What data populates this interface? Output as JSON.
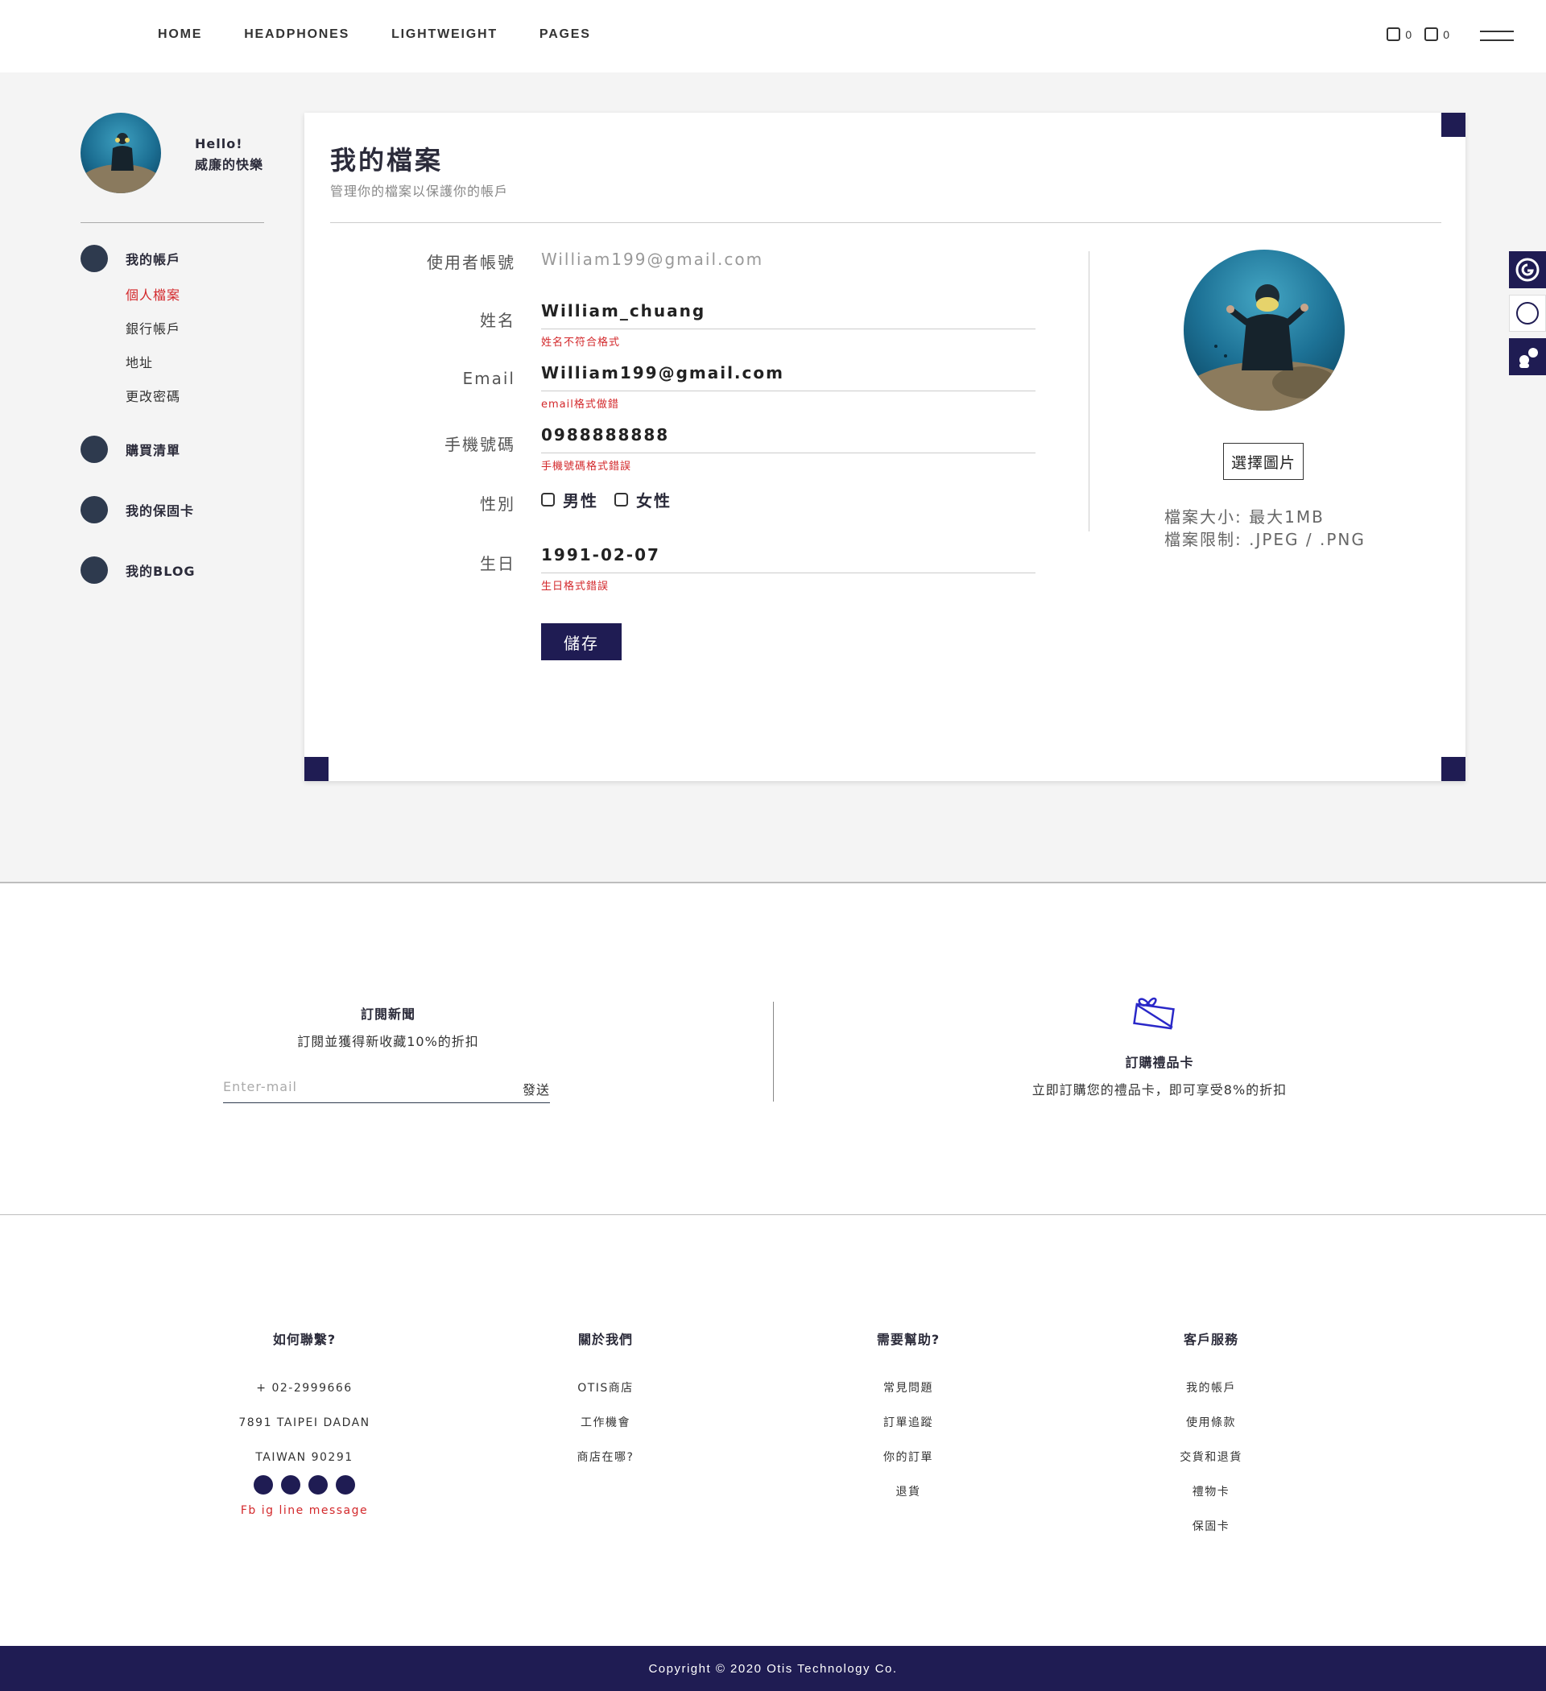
{
  "nav": {
    "items": [
      "HOME",
      "HEADPHONES",
      "LIGHTWEIGHT",
      "PAGES"
    ],
    "cart_count": "0",
    "wishlist_count": "0"
  },
  "sidebar": {
    "greeting_line1": "Hello!",
    "greeting_line2": "威廉的快樂",
    "account": "我的帳戶",
    "sub_items": [
      "個人檔案",
      "銀行帳戶",
      "地址",
      "更改密碼"
    ],
    "orders": "購買清單",
    "warranty": "我的保固卡",
    "blog": "我的BLOG"
  },
  "profile": {
    "title": "我的檔案",
    "subtitle": "管理你的檔案以保護你的帳戶",
    "username_label": "使用者帳號",
    "username_value": "William199@gmail.com",
    "name_label": "姓名",
    "name_value": "William_chuang",
    "name_error": "姓名不符合格式",
    "email_label": "Email",
    "email_value": "William199@gmail.com",
    "email_error": "email格式做錯",
    "phone_label": "手機號碼",
    "phone_value": "0988888888",
    "phone_error": "手機號碼格式錯誤",
    "gender_label": "性別",
    "gender_male": "男性",
    "gender_female": "女性",
    "birthday_label": "生日",
    "birthday_value": "1991-02-07",
    "birthday_error": "生日格式錯誤",
    "save_label": "儲存",
    "choose_image": "選擇圖片",
    "file_size": "檔案大小: 最大1MB",
    "file_types": "檔案限制: .JPEG / .PNG"
  },
  "newsletter": {
    "title": "訂閱新聞",
    "subtitle": "訂閱並獲得新收藏10%的折扣",
    "placeholder": "Enter-mail",
    "send": "發送"
  },
  "giftcard": {
    "title": "訂購禮品卡",
    "subtitle": "立即訂購您的禮品卡，即可享受8%的折扣"
  },
  "footer": {
    "contact": {
      "title": "如何聯繫?",
      "phone": "+ 02-2999666",
      "address1": "7891 TAIPEI DADAN",
      "address2": "TAIWAN 90291",
      "social_text": "Fb ig line message"
    },
    "about": {
      "title": "關於我們",
      "items": [
        "OTIS商店",
        "工作機會",
        "商店在哪?"
      ]
    },
    "help": {
      "title": "需要幫助?",
      "items": [
        "常見問題",
        "訂單追蹤",
        "你的訂單",
        "退貨"
      ]
    },
    "service": {
      "title": "客戶服務",
      "items": [
        "我的帳戶",
        "使用條款",
        "交貨和退貨",
        "禮物卡",
        "保固卡"
      ]
    },
    "copyright": "Copyright © 2020 Otis Technology Co."
  }
}
